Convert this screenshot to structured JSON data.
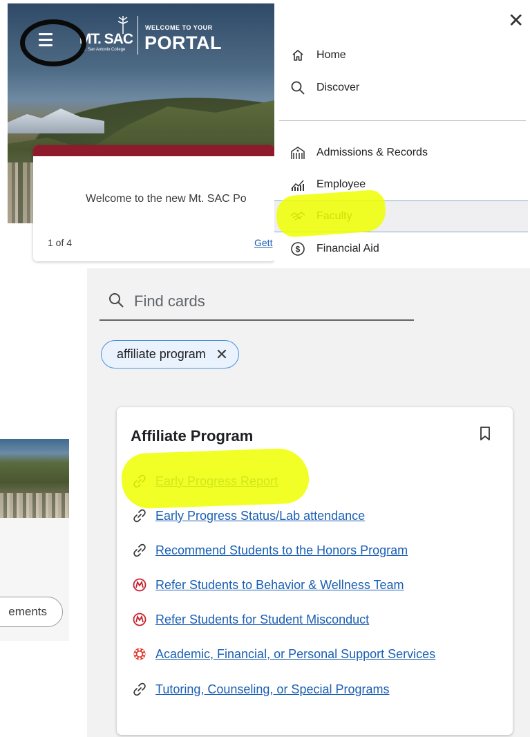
{
  "portal": {
    "logo_text": "MT. SAC",
    "logo_subtext": "Mt. San Antonio College",
    "welcome_small": "WELCOME TO YOUR",
    "welcome_big": "PORTAL",
    "carousel_message": "Welcome to the new Mt. SAC Po",
    "carousel_count": "1 of 4",
    "carousel_link": "Gett"
  },
  "side_menu": {
    "close_label": "✕",
    "items_top": [
      {
        "label": "Home",
        "icon": "home-icon"
      },
      {
        "label": "Discover",
        "icon": "search-icon"
      }
    ],
    "items_bottom": [
      {
        "label": "Admissions & Records",
        "icon": "building-icon"
      },
      {
        "label": "Employee",
        "icon": "chart-icon"
      },
      {
        "label": "Faculty",
        "icon": "handshake-icon",
        "active": true
      },
      {
        "label": "Financial Aid",
        "icon": "dollar-circle-icon"
      }
    ]
  },
  "search": {
    "placeholder": "Find cards"
  },
  "filter_chip": {
    "label": "affiliate program",
    "remove": "✕"
  },
  "card": {
    "title": "Affiliate Program",
    "links": [
      {
        "label": "Early Progress Report",
        "icon": "link-icon"
      },
      {
        "label": "Early Progress Status/Lab attendance",
        "icon": "link-icon"
      },
      {
        "label": "Recommend Students to the Honors Program",
        "icon": "link-icon"
      },
      {
        "label": "Refer Students to Behavior & Wellness Team",
        "icon": "maxient-logo-icon"
      },
      {
        "label": "Refer Students for Student Misconduct",
        "icon": "maxient-logo-icon"
      },
      {
        "label": "Academic, Financial, or Personal Support Services",
        "icon": "support-logo-icon"
      },
      {
        "label": "Tutoring, Counseling, or Special Programs",
        "icon": "link-icon"
      }
    ]
  },
  "fragment": {
    "button_label": "ements"
  },
  "colors": {
    "accent_link": "#1a5fb4",
    "highlight": "#eeff00",
    "maroon": "#8d1b2c"
  }
}
